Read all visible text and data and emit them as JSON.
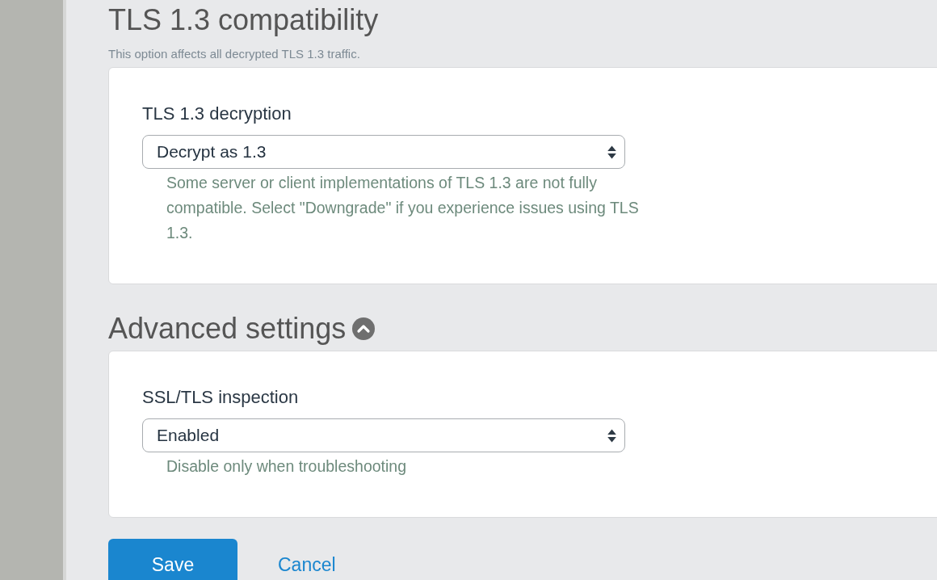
{
  "sections": [
    {
      "title": "TLS 1.3 compatibility",
      "description": "This option affects all decrypted TLS 1.3 traffic.",
      "fields": [
        {
          "label": "TLS 1.3 decryption",
          "value": "Decrypt as 1.3",
          "help": "Some server or client implementations of TLS 1.3 are not fully compatible. Select \"Downgrade\" if you experience issues using TLS 1.3."
        }
      ]
    },
    {
      "title": "Advanced settings",
      "expanded": true,
      "fields": [
        {
          "label": "SSL/TLS inspection",
          "value": "Enabled",
          "help": "Disable only when troubleshooting"
        }
      ]
    }
  ],
  "buttons": [
    {
      "label": "Save",
      "kind": "primary"
    },
    {
      "label": "Cancel",
      "kind": "link"
    }
  ]
}
